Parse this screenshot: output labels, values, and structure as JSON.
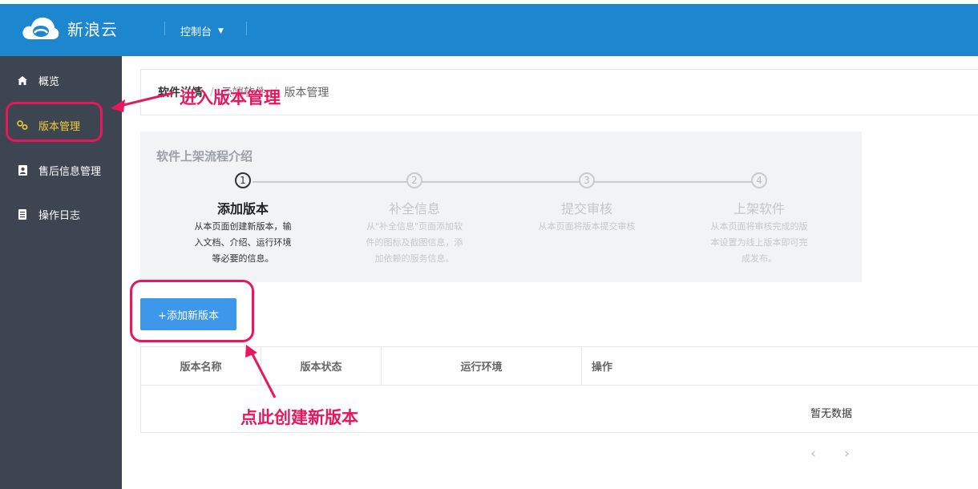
{
  "header": {
    "brand": "新浪云",
    "console_label": "控制台",
    "bg_color": "#1c87cf"
  },
  "sidebar": {
    "items": [
      {
        "label": "概览",
        "icon": "home-icon"
      },
      {
        "label": "版本管理",
        "icon": "gears-icon",
        "active": true
      },
      {
        "label": "售后信息管理",
        "icon": "contact-book-icon"
      },
      {
        "label": "操作日志",
        "icon": "log-list-icon"
      }
    ],
    "active_color": "#f1cc3a"
  },
  "breadcrumb": {
    "part1": "软件详情",
    "sep1": "/",
    "part2": "云端软件",
    "sep2": "/",
    "part3": "版本管理"
  },
  "flow": {
    "title": "软件上架流程介绍",
    "steps": [
      {
        "num": "1",
        "title": "添加版本",
        "desc": "从本页面创建新版本，输入文档、介绍、运行环境等必要的信息。",
        "current": true
      },
      {
        "num": "2",
        "title": "补全信息",
        "desc": "从\"补全信息\"页面添加软件的图标及截图信息，添加依赖的服务信息。"
      },
      {
        "num": "3",
        "title": "提交审核",
        "desc": "从本页面将版本提交审核"
      },
      {
        "num": "4",
        "title": "上架软件",
        "desc": "从本页面将审核完成的版本设置为线上版本即可完成发布。"
      }
    ]
  },
  "actions": {
    "add_version": "+添加新版本"
  },
  "table": {
    "columns": [
      "版本名称",
      "版本状态",
      "运行环境",
      "操作"
    ],
    "empty_text": "暂无数据"
  },
  "pager": {
    "prev": "‹",
    "next": "›"
  },
  "annotations": {
    "enter_version": "进入版本管理",
    "click_create": "点此创建新版本",
    "color": "#e8165c"
  }
}
